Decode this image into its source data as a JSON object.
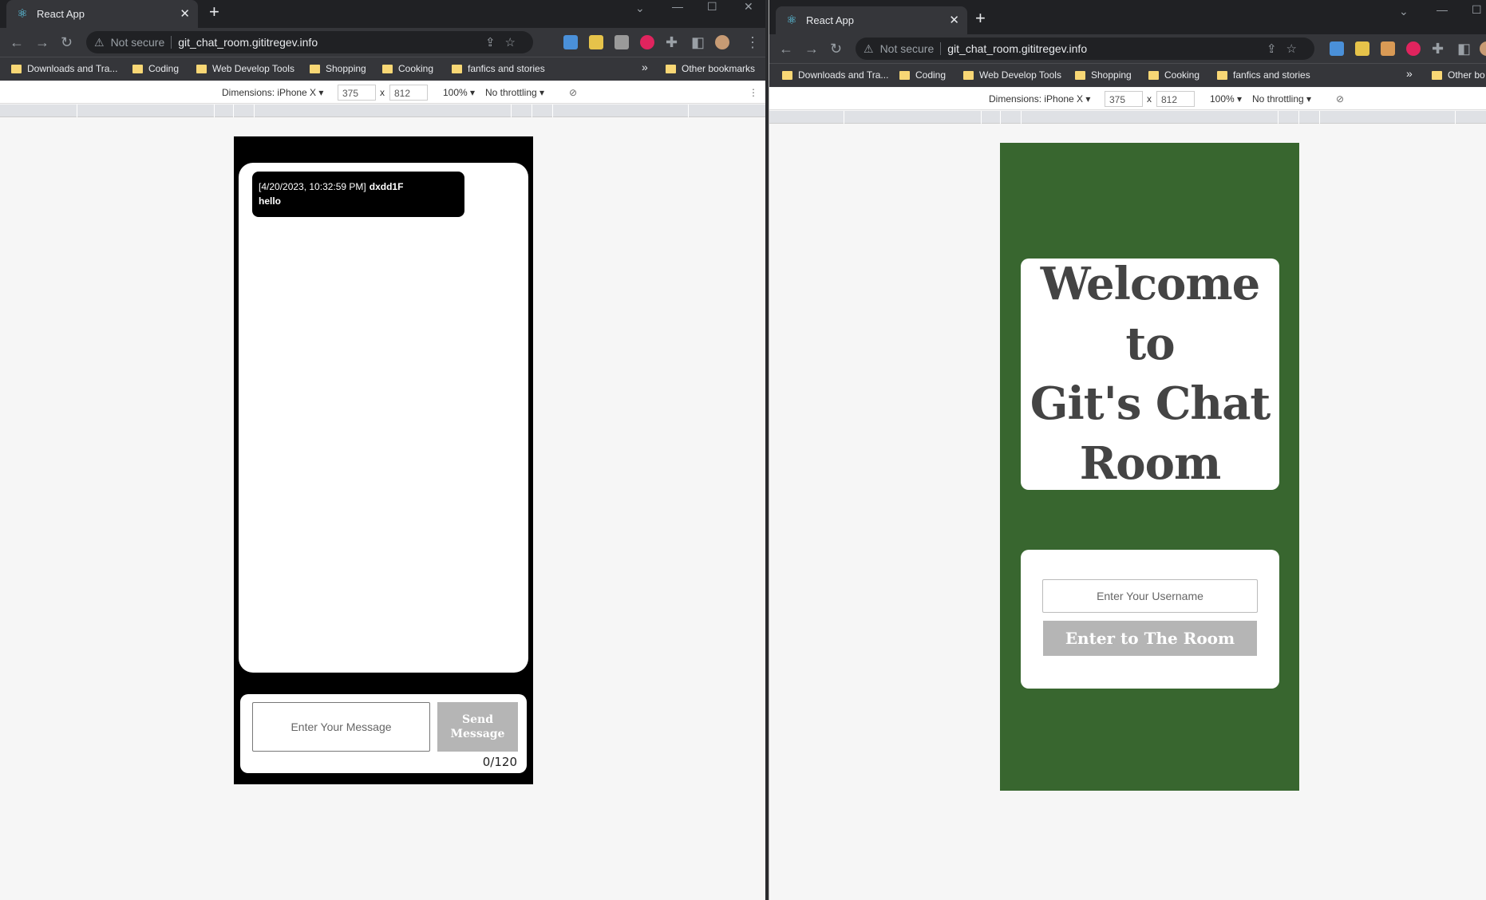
{
  "left_window": {
    "tab_title": "React App",
    "omnibox": {
      "security_label": "Not secure",
      "url": "git_chat_room.gititregev.info"
    },
    "bookmarks": [
      "Downloads and Tra...",
      "Coding",
      "Web Develop Tools",
      "Shopping",
      "Cooking",
      "fanfics and stories"
    ],
    "other_bookmarks": "Other bookmarks",
    "overflow": "»",
    "devtools": {
      "dimensions": "Dimensions: iPhone X ▾",
      "width": "375",
      "times": "x",
      "height": "812",
      "zoom": "100% ▾",
      "throttling": "No throttling ▾"
    },
    "chat": {
      "messages": [
        {
          "timestamp": "[4/20/2023, 10:32:59 PM]",
          "username": "dxdd1F",
          "text": "hello"
        }
      ],
      "input_placeholder": "Enter Your Message",
      "send_label_line1": "Send",
      "send_label_line2": "Message",
      "char_counter": "0/120"
    }
  },
  "right_window": {
    "tab_title": "React App",
    "omnibox": {
      "security_label": "Not secure",
      "url": "git_chat_room.gititregev.info"
    },
    "bookmarks": [
      "Downloads and Tra...",
      "Coding",
      "Web Develop Tools",
      "Shopping",
      "Cooking",
      "fanfics and stories"
    ],
    "other_bookmarks": "Other bo",
    "overflow": "»",
    "devtools": {
      "dimensions": "Dimensions: iPhone X ▾",
      "width": "375",
      "times": "x",
      "height": "812",
      "zoom": "100% ▾",
      "throttling": "No throttling ▾"
    },
    "login": {
      "welcome_line1": "Welcome to",
      "welcome_line2": "Git's Chat",
      "welcome_line3": "Room",
      "username_placeholder": "Enter Your Username",
      "enter_button": "Enter to The Room"
    }
  },
  "colors": {
    "chrome_dark": "#202124",
    "toolbar": "#35363a",
    "login_bg": "#38662f",
    "chat_bg": "#000000",
    "button_disabled": "#b5b5b5"
  },
  "icons": [
    "react-favicon",
    "back-arrow-icon",
    "forward-arrow-icon",
    "reload-icon",
    "warning-icon",
    "share-icon",
    "star-icon",
    "extensions-icon",
    "side-panel-icon",
    "avatar",
    "kebab-menu-icon",
    "rotate-icon"
  ]
}
